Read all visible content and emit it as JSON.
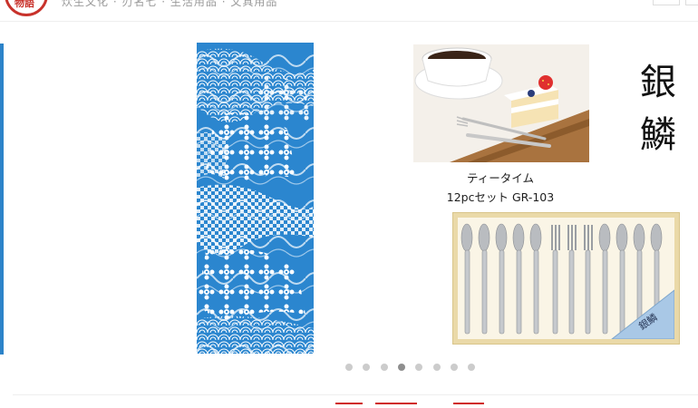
{
  "header": {
    "logo_text": "物語",
    "nav_text": "炊生文化 · 刃名七 · 生活用品 · 文具用品"
  },
  "carousel": {
    "product": {
      "title": "ティータイム",
      "subtitle": "12pcセット GR-103",
      "brand_calligraphy": "銀鱗"
    },
    "slide_count": 8,
    "active_index": 3
  },
  "colors": {
    "brand_red": "#c8322b",
    "towel_blue": "#2b86cf",
    "dot_inactive": "#cccccc",
    "dot_active": "#8e8e8e"
  }
}
